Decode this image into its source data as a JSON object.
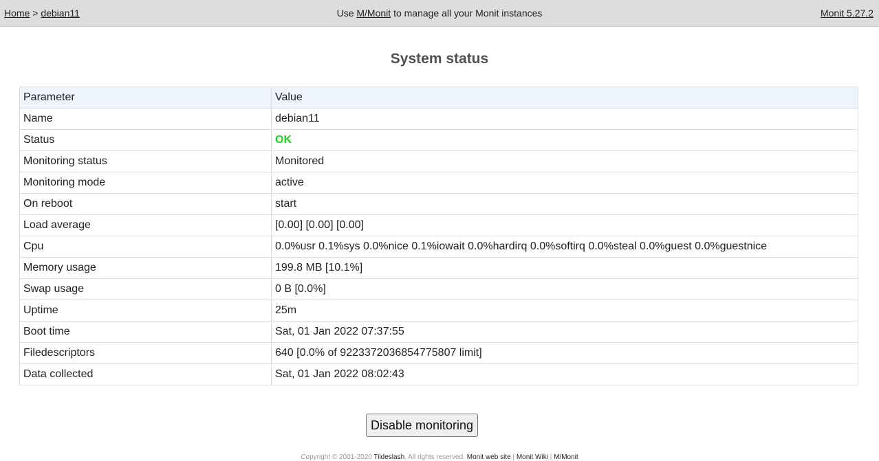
{
  "nav": {
    "home_label": "Home",
    "separator": ">",
    "host_label": "debian11",
    "promo_prefix": "Use",
    "promo_link": "M/Monit",
    "promo_suffix": "to manage all your Monit instances",
    "version_label": "Monit 5.27.2"
  },
  "page": {
    "title": "System status"
  },
  "table": {
    "headers": [
      "Parameter",
      "Value"
    ],
    "rows": [
      {
        "param": "Name",
        "value": "debian11"
      },
      {
        "param": "Status",
        "value": "OK"
      },
      {
        "param": "Monitoring status",
        "value": "Monitored"
      },
      {
        "param": "Monitoring mode",
        "value": "active"
      },
      {
        "param": "On reboot",
        "value": "start"
      },
      {
        "param": "Load average",
        "value": "[0.00] [0.00] [0.00]"
      },
      {
        "param": "Cpu",
        "value": "0.0%usr 0.1%sys 0.0%nice 0.1%iowait 0.0%hardirq 0.0%softirq 0.0%steal 0.0%guest 0.0%guestnice"
      },
      {
        "param": "Memory usage",
        "value": "199.8 MB [10.1%]"
      },
      {
        "param": "Swap usage",
        "value": "0 B [0.0%]"
      },
      {
        "param": "Uptime",
        "value": "25m"
      },
      {
        "param": "Boot time",
        "value": "Sat, 01 Jan 2022 07:37:55"
      },
      {
        "param": "Filedescriptors",
        "value": "640 [0.0% of 9223372036854775807 limit]"
      },
      {
        "param": "Data collected",
        "value": "Sat, 01 Jan 2022 08:02:43"
      }
    ],
    "status_color": "#19d619"
  },
  "actions": {
    "disable_label": "Disable monitoring"
  },
  "footer": {
    "copyright": "Copyright © 2001-2020",
    "company_link": "Tildeslash",
    "rights": ". All rights reserved.",
    "website_link": "Monit web site",
    "wiki_link": "Monit Wiki",
    "mmonit_link": "M/Monit"
  }
}
